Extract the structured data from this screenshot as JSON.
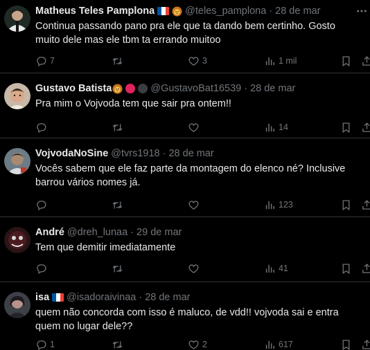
{
  "colors": {
    "background": "#000000",
    "text_primary": "#e7e9ea",
    "text_secondary": "#71767b",
    "divider": "#2f3336"
  },
  "icons": {
    "reply": "reply-icon",
    "retweet": "retweet-icon",
    "like": "like-icon",
    "views": "views-icon",
    "bookmark": "bookmark-icon",
    "share": "share-icon",
    "more": "more-icon"
  },
  "tweets": [
    {
      "name": "Matheus Teles Pamplona",
      "handle": "@teles_pamplona",
      "separator": "·",
      "date": "28 de mar",
      "text": "Continua passando pano pra ele que ta dando bem certinho. Gosto muito dele mas ele tbm ta errando muitoo",
      "replies": "7",
      "retweets": "",
      "likes": "3",
      "views": "1 mil"
    },
    {
      "name": "Gustavo Batista",
      "handle": "@GustavoBat16539",
      "separator": "·",
      "date": "28 de mar",
      "text": "Pra mim o Vojvoda tem que sair pra ontem!!",
      "replies": "",
      "retweets": "",
      "likes": "",
      "views": "14"
    },
    {
      "name": "VojvodaNoSine",
      "handle": "@tvrs1918",
      "separator": "·",
      "date": "28 de mar",
      "text": "Vocês sabem que ele faz parte da montagem do elenco né? Inclusive barrou vários nomes já.",
      "replies": "",
      "retweets": "",
      "likes": "",
      "views": "123"
    },
    {
      "name": "André",
      "handle": "@dreh_lunaa",
      "separator": "·",
      "date": "29 de mar",
      "text": "Tem que demitir imediatamente",
      "replies": "",
      "retweets": "",
      "likes": "",
      "views": "41"
    },
    {
      "name": "isa",
      "handle": "@isadoraivinaa",
      "separator": "·",
      "date": "28 de mar",
      "text": "quem não concorda com isso é maluco, de vdd!! vojvoda sai e entra quem no lugar dele??",
      "replies": "1",
      "retweets": "",
      "likes": "2",
      "views": "617"
    }
  ]
}
